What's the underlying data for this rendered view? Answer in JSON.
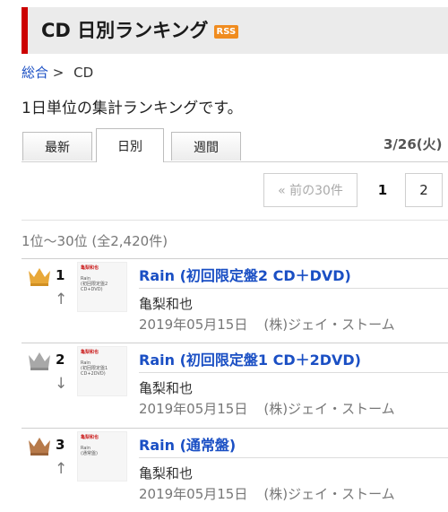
{
  "header": {
    "title": "CD 日別ランキング",
    "rss_label": "RSS"
  },
  "breadcrumb": {
    "home": "総合",
    "separator": ">",
    "current": "CD"
  },
  "description": "1日単位の集計ランキングです。",
  "tabs": [
    {
      "label": "最新",
      "active": false
    },
    {
      "label": "日別",
      "active": true
    },
    {
      "label": "週間",
      "active": false
    }
  ],
  "date": "3/26(火)",
  "pager": {
    "prev_label": "« 前の30件",
    "current_page": "1",
    "next_page": "2"
  },
  "range_text": "1位～30位 (全2,420件)",
  "items": [
    {
      "rank": "1",
      "crown": "gold",
      "trend": "↑",
      "title": "Rain (初回限定盤2 CD＋DVD)",
      "artist": "亀梨和也",
      "date": "2019年05月15日",
      "label": "(株)ジェイ・ストーム",
      "thumb_artist": "亀梨和也",
      "thumb_lines": [
        "Rain",
        "(初回限定盤2",
        "CD+DVD)"
      ]
    },
    {
      "rank": "2",
      "crown": "silver",
      "trend": "↓",
      "title": "Rain (初回限定盤1 CD＋2DVD)",
      "artist": "亀梨和也",
      "date": "2019年05月15日",
      "label": "(株)ジェイ・ストーム",
      "thumb_artist": "亀梨和也",
      "thumb_lines": [
        "Rain",
        "(初回限定盤1",
        "CD+2DVD)"
      ]
    },
    {
      "rank": "3",
      "crown": "bronze",
      "trend": "↑",
      "title": "Rain (通常盤)",
      "artist": "亀梨和也",
      "date": "2019年05月15日",
      "label": "(株)ジェイ・ストーム",
      "thumb_artist": "亀梨和也",
      "thumb_lines": [
        "Rain",
        "(通常盤)"
      ]
    }
  ],
  "colors": {
    "accent": "#cc0000",
    "link": "#1a4fc4",
    "rss": "#f08c1f",
    "gold": "#e8a838",
    "silver": "#a8a8a8",
    "bronze": "#b77a4a"
  }
}
